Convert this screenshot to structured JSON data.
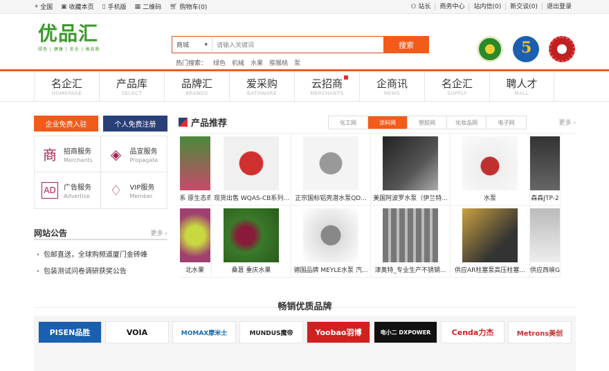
{
  "topbar": {
    "left": [
      {
        "icon": "location-icon",
        "label": "全国"
      },
      {
        "icon": "bookmark-icon",
        "label": "收藏本页"
      },
      {
        "icon": "mobile-icon",
        "label": "手机版"
      },
      {
        "icon": "qrcode-icon",
        "label": "二维码"
      },
      {
        "icon": "cart-icon",
        "label": "购物车(0)"
      }
    ],
    "right": [
      "站长",
      "商务中心",
      "站内信(0)",
      "新交谈(0)",
      "退出登录"
    ]
  },
  "logo": {
    "main": "优品汇",
    "tagline": "绿色 | 健康 | 安全 | 高品质"
  },
  "search": {
    "category": "商城",
    "placeholder": "请输入关键词",
    "button": "搜索"
  },
  "hot": {
    "label": "热门搜索：",
    "items": [
      "绿色",
      "机械",
      "水果",
      "猕猴桃",
      "泵"
    ]
  },
  "nav": [
    {
      "cn": "名企汇",
      "en": "HOMEPAGE"
    },
    {
      "cn": "产品库",
      "en": "SELECT"
    },
    {
      "cn": "品牌汇",
      "en": "BRANDS"
    },
    {
      "cn": "爱采购",
      "en": "BATHWARE"
    },
    {
      "cn": "云招商",
      "en": "MERCHANTS"
    },
    {
      "cn": "企商讯",
      "en": "NEWS"
    },
    {
      "cn": "名企汇",
      "en": "SUPPLY"
    },
    {
      "cn": "聘人才",
      "en": "MALL"
    }
  ],
  "register": {
    "company": "企业免费入驻",
    "personal": "个人免费注册"
  },
  "services": [
    {
      "icon": "merchants-icon",
      "title": "招商服务",
      "en": "Merchants"
    },
    {
      "icon": "propagate-icon",
      "title": "品宣服务",
      "en": "Propagate"
    },
    {
      "icon": "advertise-icon",
      "title": "广告服务",
      "en": "Advertise"
    },
    {
      "icon": "vip-icon",
      "title": "VIP服务",
      "en": "Member"
    }
  ],
  "notice": {
    "title": "网站公告",
    "more": "更多",
    "items": [
      "包邮直送，全球购频道厦门金砖峰",
      "包装测试问卷调研获奖公告"
    ]
  },
  "products": {
    "title": "产品推荐",
    "more": "更多",
    "tabs": [
      "化工网",
      "涂料网",
      "塑胶网",
      "化妆品网",
      "电子网"
    ],
    "active_tab": 1,
    "row1": [
      "系 原生态奇异...",
      "现货出售 WQAS-CB系列...",
      "正宗国标铝壳潜水泵QD...",
      "美国阿波罗水泵（伊兰特...",
      "水泵",
      "森森JTP-2"
    ],
    "row2": [
      "北水果",
      "桑葚 重庆水果",
      "德国品牌 MEYLE水泵 汽...",
      "津奥特_专业生产不锈钢...",
      "供应AR柱塞泵高压柱塞...",
      "供应西峡G"
    ]
  },
  "brands": {
    "title": "畅销优质品牌",
    "items": [
      "PISEN品胜",
      "VOIA",
      "MOMAX摩米士",
      "MUNDUS魔帝",
      "Yoobao羽博",
      "电小二 DXPOWER",
      "Cenda力杰",
      "Metrons美创"
    ]
  },
  "colors": {
    "accent": "#f25b1a",
    "navy": "#2a3f78",
    "green": "#3a9a2a"
  }
}
